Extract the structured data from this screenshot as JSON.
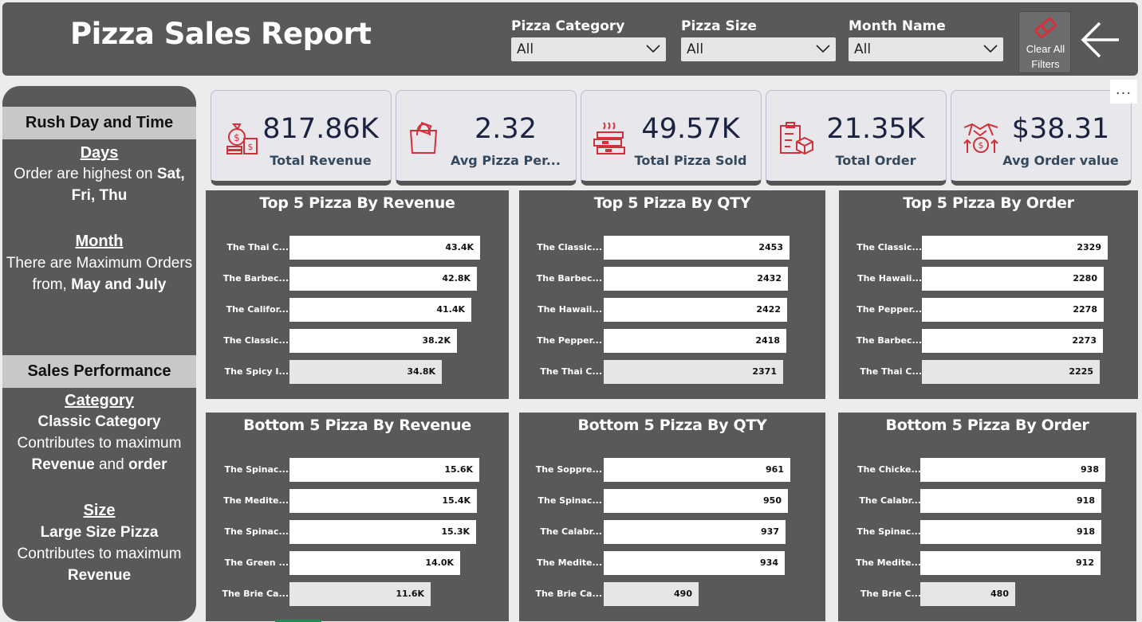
{
  "header": {
    "title": "Pizza Sales Report",
    "filters": [
      {
        "label": "Pizza Category",
        "value": "All"
      },
      {
        "label": "Pizza Size",
        "value": "All"
      },
      {
        "label": "Month Name",
        "value": "All"
      }
    ],
    "clear_line1": "Clear All",
    "clear_line2": "Filters",
    "back_icon": "back-arrow-icon"
  },
  "sidebar": {
    "rush_heading": "Rush Day and Time",
    "days_label": "Days",
    "days_text_pre": "Order are highest on ",
    "days_text_bold": "Sat, Fri, Thu",
    "month_label": "Month",
    "month_text_pre": "There are Maximum Orders from, ",
    "month_text_bold": "May and July",
    "sales_heading": "Sales Performance",
    "category_label": "Category",
    "category_bold": "Classic Category",
    "category_mid": " Contributes to maximum ",
    "category_b1": "Revenue",
    "category_and": " and ",
    "category_b2": "order",
    "size_label": "Size",
    "size_bold": "Large Size Pizza",
    "size_mid": " Contributes to maximum ",
    "size_b1": "Revenue"
  },
  "kpis": [
    {
      "value": "817.86K",
      "label": "Total Revenue",
      "icon": "money-bag-icon"
    },
    {
      "value": "2.32",
      "label": "Avg Pizza Per...",
      "icon": "shopping-bag-icon"
    },
    {
      "value": "49.57K",
      "label": "Total Pizza Sold",
      "icon": "pizza-boxes-icon"
    },
    {
      "value": "21.35K",
      "label": "Total Order",
      "icon": "order-clipboard-icon"
    },
    {
      "value": "$38.31",
      "label": "Avg Order value",
      "icon": "handshake-coin-icon"
    }
  ],
  "more_options": "...",
  "colors": {
    "panel": "#595959",
    "accent": "#d0313b",
    "bar": "#ffffff",
    "bar_dim": "#e6e6e6"
  },
  "chart_data": [
    {
      "type": "bar",
      "title": "Top 5 Pizza By Revenue",
      "categories": [
        "The Thai C...",
        "The Barbec...",
        "The Califor...",
        "The Classic...",
        "The Spicy I..."
      ],
      "values": [
        43.4,
        42.8,
        41.4,
        38.2,
        34.8
      ],
      "labels": [
        "43.4K",
        "42.8K",
        "41.4K",
        "38.2K",
        "34.8K"
      ],
      "xlim": [
        0,
        50
      ]
    },
    {
      "type": "bar",
      "title": "Top 5 Pizza By QTY",
      "categories": [
        "The Classic...",
        "The Barbec...",
        "The Hawaii...",
        "The Pepper...",
        "The Thai C..."
      ],
      "values": [
        2453,
        2432,
        2422,
        2418,
        2371
      ],
      "labels": [
        "2453",
        "2432",
        "2422",
        "2418",
        "2371"
      ],
      "xlim": [
        0,
        2900
      ]
    },
    {
      "type": "bar",
      "title": "Top 5 Pizza By Order",
      "categories": [
        "The Classic...",
        "The Hawaii...",
        "The Pepper...",
        "The Barbec...",
        "The Thai C..."
      ],
      "values": [
        2329,
        2280,
        2278,
        2273,
        2225
      ],
      "labels": [
        "2329",
        "2280",
        "2278",
        "2273",
        "2225"
      ],
      "xlim": [
        0,
        2750
      ]
    },
    {
      "type": "bar",
      "title": "Bottom 5 Pizza By Revenue",
      "categories": [
        "The Spinac...",
        "The Medite...",
        "The Spinac...",
        "The Green ...",
        "The Brie Ca..."
      ],
      "values": [
        15.6,
        15.4,
        15.3,
        14.0,
        11.6
      ],
      "labels": [
        "15.6K",
        "15.4K",
        "15.3K",
        "14.0K",
        "11.6K"
      ],
      "xlim": [
        0,
        18
      ]
    },
    {
      "type": "bar",
      "title": "Bottom 5 Pizza By QTY",
      "categories": [
        "The Soppre...",
        "The Spinac...",
        "The Calabr...",
        "The Medite...",
        "The Brie Ca..."
      ],
      "values": [
        961,
        950,
        937,
        934,
        490
      ],
      "labels": [
        "961",
        "950",
        "937",
        "934",
        "490"
      ],
      "xlim": [
        0,
        1130
      ]
    },
    {
      "type": "bar",
      "title": "Bottom 5 Pizza By Order",
      "categories": [
        "The Chicke...",
        "The Calabr...",
        "The Spinac...",
        "The Medite...",
        "The Brie C..."
      ],
      "values": [
        938,
        918,
        918,
        912,
        480
      ],
      "labels": [
        "938",
        "918",
        "918",
        "912",
        "480"
      ],
      "xlim": [
        0,
        1110
      ]
    }
  ]
}
